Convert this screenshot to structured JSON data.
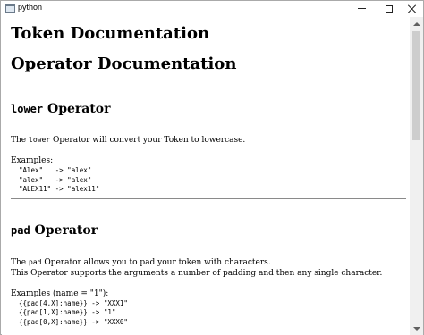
{
  "window": {
    "title": "python"
  },
  "page": {
    "h1_token": "Token Documentation",
    "h1_operator": "Operator Documentation",
    "lower": {
      "name": "lower",
      "heading_suffix": " Operator",
      "desc_prefix": "The ",
      "desc_suffix": " Operator will convert your Token to lowercase.",
      "examples_label": "Examples:",
      "examples": [
        "\"Alex\"   -> \"alex\"",
        "\"alex\"   -> \"alex\"",
        "\"ALEX11\" -> \"alex11\""
      ]
    },
    "pad": {
      "name": "pad",
      "heading_suffix": " Operator",
      "desc_prefix": "The ",
      "desc_suffix": " Operator allows you to pad your token with characters.",
      "desc_line2": "This Operator supports the arguments a number of padding and then any single character.",
      "examples_label": "Examples (name = \"1\"):",
      "examples": [
        "{{pad[4,X]:name}} -> \"XXX1\"",
        "{{pad[1,X]:name}} -> \"1\"",
        "{{pad[0,X]:name}} -> \"XXX0\""
      ]
    }
  }
}
